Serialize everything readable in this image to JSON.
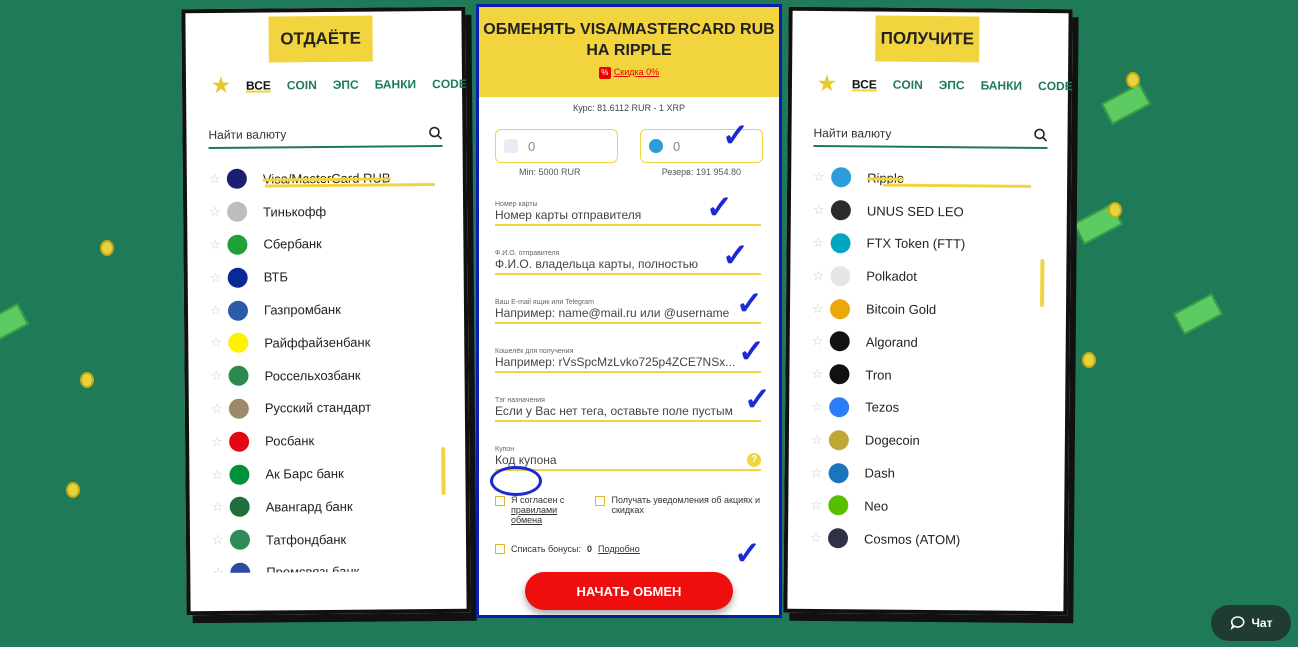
{
  "left_panel": {
    "title": "ОТДАЁТЕ",
    "filters": [
      "ВСЕ",
      "COIN",
      "ЭПС",
      "БАНКИ",
      "CODE"
    ],
    "search_placeholder": "Найти валюту",
    "items": [
      {
        "label": "Visa/MasterCard RUB",
        "icon": "visa-mastercard-icon",
        "color": "#1a1f71"
      },
      {
        "label": "Тинькофф",
        "icon": "tinkoff-icon",
        "color": "#bdbdbd"
      },
      {
        "label": "Сбербанк",
        "icon": "sberbank-icon",
        "color": "#21a038"
      },
      {
        "label": "ВТБ",
        "icon": "vtb-icon",
        "color": "#0a2896"
      },
      {
        "label": "Газпромбанк",
        "icon": "gazprombank-icon",
        "color": "#2c5ba8"
      },
      {
        "label": "Райффайзенбанк",
        "icon": "raiffeisen-icon",
        "color": "#fff200"
      },
      {
        "label": "Россельхозбанк",
        "icon": "rosselkhozbank-icon",
        "color": "#2d8a4e"
      },
      {
        "label": "Русский стандарт",
        "icon": "russian-standard-icon",
        "color": "#9e8a6a"
      },
      {
        "label": "Росбанк",
        "icon": "rosbank-icon",
        "color": "#e30613"
      },
      {
        "label": "Ак Барс банк",
        "icon": "ak-bars-icon",
        "color": "#00913a"
      },
      {
        "label": "Авангард банк",
        "icon": "avangard-icon",
        "color": "#1f6f3e"
      },
      {
        "label": "Татфондбанк",
        "icon": "tatfondbank-icon",
        "color": "#2e8b57"
      },
      {
        "label": "Промсвязьбанк",
        "icon": "promsvyazbank-icon",
        "color": "#2b4aa3"
      }
    ]
  },
  "right_panel": {
    "title": "ПОЛУЧИТЕ",
    "filters": [
      "ВСЕ",
      "COIN",
      "ЭПС",
      "БАНКИ",
      "CODE"
    ],
    "search_placeholder": "Найти валюту",
    "items": [
      {
        "label": "Ripple",
        "icon": "ripple-icon",
        "color": "#2d9cdb"
      },
      {
        "label": "UNUS SED LEO",
        "icon": "leo-icon",
        "color": "#2b2b2b"
      },
      {
        "label": "FTX Token (FTT)",
        "icon": "ftx-icon",
        "color": "#02a6c2"
      },
      {
        "label": "Polkadot",
        "icon": "polkadot-icon",
        "color": "#e6e6e6"
      },
      {
        "label": "Bitcoin Gold",
        "icon": "bitcoin-gold-icon",
        "color": "#eba809"
      },
      {
        "label": "Algorand",
        "icon": "algorand-icon",
        "color": "#111111"
      },
      {
        "label": "Tron",
        "icon": "tron-icon",
        "color": "#111111"
      },
      {
        "label": "Tezos",
        "icon": "tezos-icon",
        "color": "#2c7df7"
      },
      {
        "label": "Dogecoin",
        "icon": "dogecoin-icon",
        "color": "#c2a633"
      },
      {
        "label": "Dash",
        "icon": "dash-icon",
        "color": "#1c75bc"
      },
      {
        "label": "Neo",
        "icon": "neo-icon",
        "color": "#58bf00"
      },
      {
        "label": "Cosmos (ATOM)",
        "icon": "cosmos-icon",
        "color": "#2e3148"
      }
    ]
  },
  "form": {
    "title": "ОБМЕНЯТЬ VISA/MASTERCARD RUB НА RIPPLE",
    "discount": "Скидка 0%",
    "rate": "Курс: 81.6112 RUR - 1 XRP",
    "give_amount": "0",
    "get_amount": "0",
    "min_note": "Min: 5000 RUR",
    "reserve_note": "Резерв: 191 954.80",
    "fields": [
      {
        "caption": "Номер карты",
        "placeholder": "Номер карты отправителя"
      },
      {
        "caption": "Ф.И.О. отправителя",
        "placeholder": "Ф.И.О. владельца карты, полностью"
      },
      {
        "caption": "Ваш E-mail ящик или Telegram",
        "placeholder": "Например: name@mail.ru или @username"
      },
      {
        "caption": "Кошелёк для получения",
        "placeholder": "Например: rVsSpcMzLvko725p4ZCE7NSx..."
      },
      {
        "caption": "Тэг назначения",
        "placeholder": "Если у Вас нет тега, оставьте поле пустым"
      }
    ],
    "coupon_caption": "Купон",
    "coupon_placeholder": "Код купона",
    "agree_text": "Я согласен с",
    "agree_link": "правилами обмена",
    "notify_text": "Получать уведомления об акциях и скидках",
    "bonus_label": "Списать бонусы:",
    "bonus_value": "0",
    "bonus_link": "Подробно",
    "submit": "НАЧАТЬ ОБМЕН"
  },
  "chat": {
    "label": "Чат"
  },
  "colors": {
    "background": "#1f7a57",
    "accent": "#f2d43e",
    "button": "#ee0e0e",
    "frame": "#0c1bb0"
  }
}
